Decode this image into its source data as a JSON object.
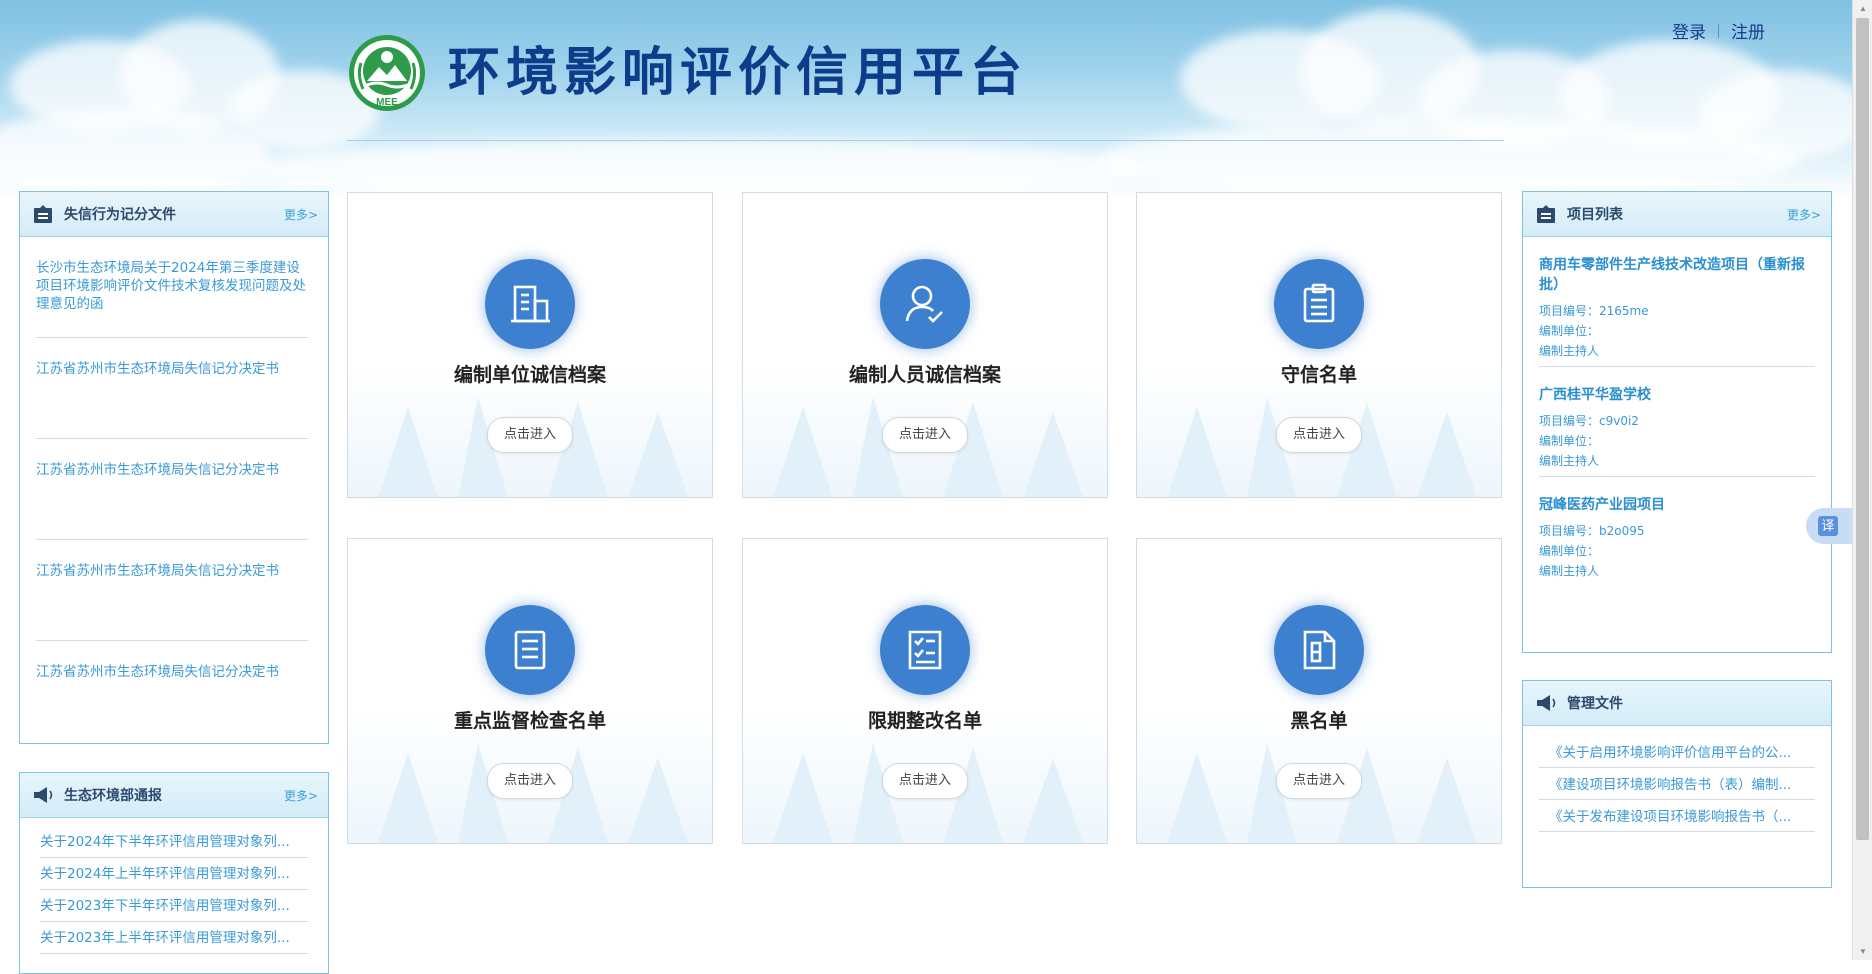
{
  "header": {
    "site_title": "环境影响评价信用平台",
    "logo_text": "MEE",
    "login": "登录",
    "register": "注册"
  },
  "credit_docs": {
    "title": "失信行为记分文件",
    "more": "更多>",
    "items": [
      "长沙市生态环境局关于2024年第三季度建设项目环境影响评价文件技术复核发现问题及处理意见的函",
      "江苏省苏州市生态环境局失信记分决定书",
      "江苏省苏州市生态环境局失信记分决定书",
      "江苏省苏州市生态环境局失信记分决定书",
      "江苏省苏州市生态环境局失信记分决定书"
    ]
  },
  "bulletin": {
    "title": "生态环境部通报",
    "more": "更多>",
    "items": [
      "关于2024年下半年环评信用管理对象列...",
      "关于2024年上半年环评信用管理对象列...",
      "关于2023年下半年环评信用管理对象列...",
      "关于2023年上半年环评信用管理对象列..."
    ]
  },
  "cards": [
    {
      "title": "编制单位诚信档案",
      "button": "点击进入",
      "icon": "building-icon"
    },
    {
      "title": "编制人员诚信档案",
      "button": "点击进入",
      "icon": "user-check-icon"
    },
    {
      "title": "守信名单",
      "button": "点击进入",
      "icon": "clipboard-icon"
    },
    {
      "title": "重点监督检查名单",
      "button": "点击进入",
      "icon": "document-list-icon"
    },
    {
      "title": "限期整改名单",
      "button": "点击进入",
      "icon": "checklist-icon"
    },
    {
      "title": "黑名单",
      "button": "点击进入",
      "icon": "file-icon"
    }
  ],
  "projects": {
    "title": "项目列表",
    "more": "更多>",
    "items": [
      {
        "name": "商用车零部件生产线技术改造项目（重新报批）",
        "code": "项目编号：2165me",
        "unit": "编制单位：",
        "host": "编制主持人"
      },
      {
        "name": "广西桂平华盈学校",
        "code": "项目编号：c9v0i2",
        "unit": "编制单位：",
        "host": "编制主持人"
      },
      {
        "name": "冠峰医药产业园项目",
        "code": "项目编号：b2o095",
        "unit": "编制单位：",
        "host": "编制主持人"
      }
    ]
  },
  "management_docs": {
    "title": "管理文件",
    "items": [
      "《关于启用环境影响评价信用平台的公...",
      "《建设项目环境影响报告书（表）编制...",
      "《关于发布建设项目环境影响报告书（..."
    ]
  },
  "translate_label": "译"
}
